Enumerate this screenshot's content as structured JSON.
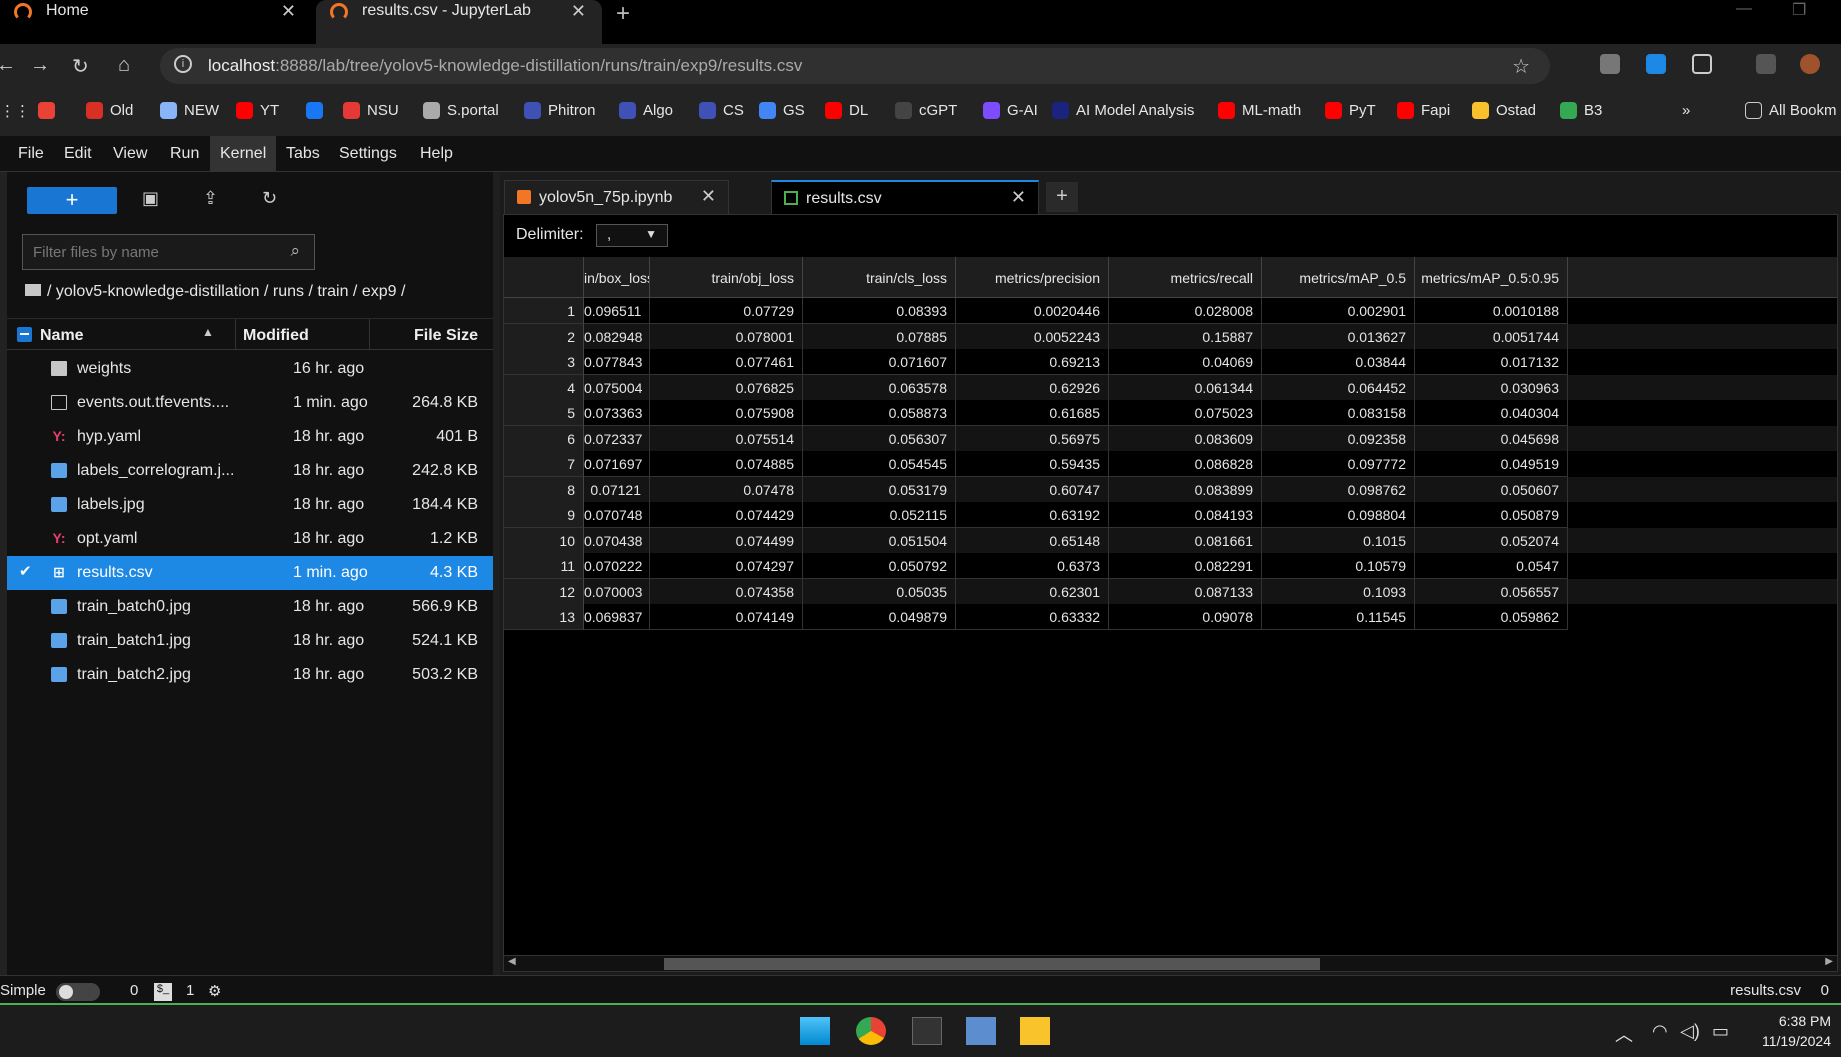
{
  "browser": {
    "tabs": [
      {
        "title": "Home"
      },
      {
        "title": "results.csv - JupyterLab"
      }
    ],
    "url_host": "localhost",
    "url_rest": ":8888/lab/tree/yolov5-knowledge-distillation/runs/train/exp9/results.csv",
    "bookmarks": [
      {
        "label": "",
        "color": "#ea4335"
      },
      {
        "label": "Old",
        "color": "#d93025"
      },
      {
        "label": "NEW",
        "color": "#8ab4f8"
      },
      {
        "label": "YT",
        "color": "#ff0000"
      },
      {
        "label": "",
        "color": "#1877f2"
      },
      {
        "label": "NSU",
        "color": "#e53935"
      },
      {
        "label": "S.portal",
        "color": "#aaaaaa"
      },
      {
        "label": "Phitron",
        "color": "#3f51b5"
      },
      {
        "label": "Algo",
        "color": "#3f51b5"
      },
      {
        "label": "CS",
        "color": "#3f51b5"
      },
      {
        "label": "GS",
        "color": "#4285f4"
      },
      {
        "label": "DL",
        "color": "#ff0000"
      },
      {
        "label": "cGPT",
        "color": "#444444"
      },
      {
        "label": "G-AI",
        "color": "#7c4dff"
      },
      {
        "label": "AI Model Analysis",
        "color": "#1a237e"
      },
      {
        "label": "ML-math",
        "color": "#ff0000"
      },
      {
        "label": "PyT",
        "color": "#ff0000"
      },
      {
        "label": "Fapi",
        "color": "#ff0000"
      },
      {
        "label": "Ostad",
        "color": "#fbc02d"
      },
      {
        "label": "B3",
        "color": "#34a853"
      }
    ],
    "bookmarks_more": "»",
    "all_bookmarks": "All Bookm"
  },
  "jupyter": {
    "menu": [
      "File",
      "Edit",
      "View",
      "Run",
      "Kernel",
      "Tabs",
      "Settings",
      "Help"
    ],
    "active_menu": "Kernel",
    "filebrowser": {
      "new_label": "+",
      "filter_placeholder": "Filter files by name",
      "breadcrumb": "/ yolov5-knowledge-distillation / runs / train / exp9 /",
      "columns": {
        "name": "Name",
        "modified": "Modified",
        "size": "File Size"
      },
      "files": [
        {
          "name": "weights",
          "type": "folder",
          "modified": "16 hr. ago",
          "size": ""
        },
        {
          "name": "events.out.tfevents....",
          "type": "file",
          "modified": "1 min. ago",
          "size": "264.8 KB"
        },
        {
          "name": "hyp.yaml",
          "type": "yaml",
          "modified": "18 hr. ago",
          "size": "401 B"
        },
        {
          "name": "labels_correlogram.j...",
          "type": "image",
          "modified": "18 hr. ago",
          "size": "242.8 KB"
        },
        {
          "name": "labels.jpg",
          "type": "image",
          "modified": "18 hr. ago",
          "size": "184.4 KB"
        },
        {
          "name": "opt.yaml",
          "type": "yaml",
          "modified": "18 hr. ago",
          "size": "1.2 KB"
        },
        {
          "name": "results.csv",
          "type": "csv",
          "modified": "1 min. ago",
          "size": "4.3 KB",
          "selected": true
        },
        {
          "name": "train_batch0.jpg",
          "type": "image",
          "modified": "18 hr. ago",
          "size": "566.9 KB"
        },
        {
          "name": "train_batch1.jpg",
          "type": "image",
          "modified": "18 hr. ago",
          "size": "524.1 KB"
        },
        {
          "name": "train_batch2.jpg",
          "type": "image",
          "modified": "18 hr. ago",
          "size": "503.2 KB"
        }
      ]
    },
    "doc_tabs": [
      {
        "label": "yolov5n_75p.ipynb",
        "active": false
      },
      {
        "label": "results.csv",
        "active": true
      }
    ],
    "csv": {
      "delimiter_label": "Delimiter:",
      "delimiter_value": ",",
      "columns": [
        "in/box_loss",
        "train/obj_loss",
        "train/cls_loss",
        "metrics/precision",
        "metrics/recall",
        "metrics/mAP_0.5",
        "metrics/mAP_0.5:0.95"
      ],
      "rows": [
        [
          "1",
          "0.096511",
          "0.07729",
          "0.08393",
          "0.0020446",
          "0.028008",
          "0.002901",
          "0.0010188"
        ],
        [
          "2",
          "0.082948",
          "0.078001",
          "0.07885",
          "0.0052243",
          "0.15887",
          "0.013627",
          "0.0051744"
        ],
        [
          "3",
          "0.077843",
          "0.077461",
          "0.071607",
          "0.69213",
          "0.04069",
          "0.03844",
          "0.017132"
        ],
        [
          "4",
          "0.075004",
          "0.076825",
          "0.063578",
          "0.62926",
          "0.061344",
          "0.064452",
          "0.030963"
        ],
        [
          "5",
          "0.073363",
          "0.075908",
          "0.058873",
          "0.61685",
          "0.075023",
          "0.083158",
          "0.040304"
        ],
        [
          "6",
          "0.072337",
          "0.075514",
          "0.056307",
          "0.56975",
          "0.083609",
          "0.092358",
          "0.045698"
        ],
        [
          "7",
          "0.071697",
          "0.074885",
          "0.054545",
          "0.59435",
          "0.086828",
          "0.097772",
          "0.049519"
        ],
        [
          "8",
          "0.07121",
          "0.07478",
          "0.053179",
          "0.60747",
          "0.083899",
          "0.098762",
          "0.050607"
        ],
        [
          "9",
          "0.070748",
          "0.074429",
          "0.052115",
          "0.63192",
          "0.084193",
          "0.098804",
          "0.050879"
        ],
        [
          "10",
          "0.070438",
          "0.074499",
          "0.051504",
          "0.65148",
          "0.081661",
          "0.1015",
          "0.052074"
        ],
        [
          "11",
          "0.070222",
          "0.074297",
          "0.050792",
          "0.6373",
          "0.082291",
          "0.10579",
          "0.0547"
        ],
        [
          "12",
          "0.070003",
          "0.074358",
          "0.05035",
          "0.62301",
          "0.087133",
          "0.1093",
          "0.056557"
        ],
        [
          "13",
          "0.069837",
          "0.074149",
          "0.049879",
          "0.63332",
          "0.09078",
          "0.11545",
          "0.059862"
        ]
      ]
    },
    "status": {
      "mode_label": "Simple",
      "terminals": "0",
      "kernels": "1",
      "filename": "results.csv",
      "line": "0"
    }
  },
  "taskbar": {
    "time": "6:38 PM",
    "date": "11/19/2024"
  }
}
